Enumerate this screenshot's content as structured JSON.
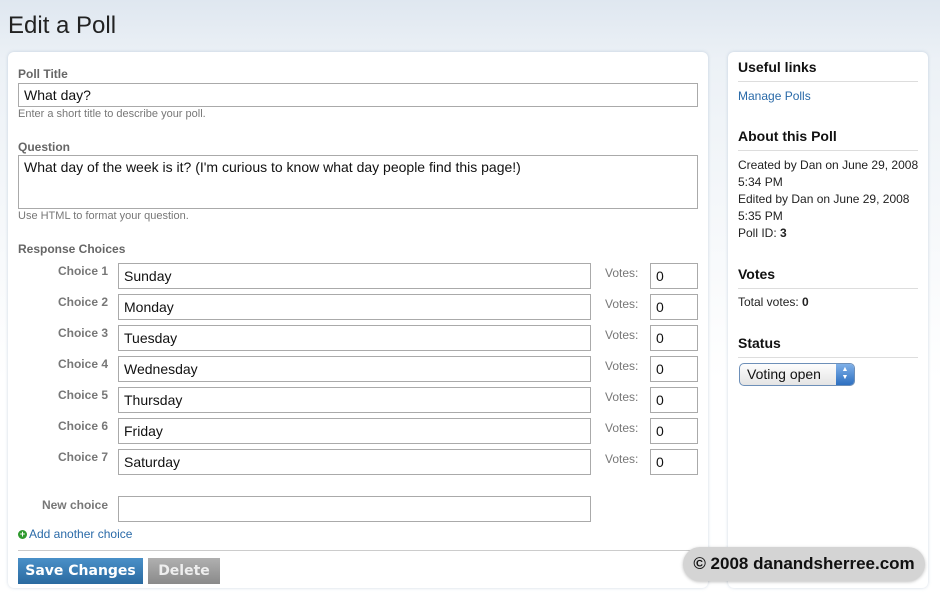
{
  "page": {
    "title": "Edit a Poll"
  },
  "form": {
    "poll_title": {
      "label": "Poll Title",
      "value": "What day?",
      "help": "Enter a short title to describe your poll."
    },
    "question": {
      "label": "Question",
      "value": "What day of the week is it? (I'm curious to know what day people find this page!)",
      "help": "Use HTML to format your question."
    },
    "responses_label": "Response Choices",
    "votes_label": "Votes:",
    "choices": [
      {
        "label": "Choice 1",
        "value": "Sunday",
        "votes": "0"
      },
      {
        "label": "Choice 2",
        "value": "Monday",
        "votes": "0"
      },
      {
        "label": "Choice 3",
        "value": "Tuesday",
        "votes": "0"
      },
      {
        "label": "Choice 4",
        "value": "Wednesday",
        "votes": "0"
      },
      {
        "label": "Choice 5",
        "value": "Thursday",
        "votes": "0"
      },
      {
        "label": "Choice 6",
        "value": "Friday",
        "votes": "0"
      },
      {
        "label": "Choice 7",
        "value": "Saturday",
        "votes": "0"
      }
    ],
    "new_choice": {
      "label": "New choice",
      "value": ""
    },
    "add_choice_link": "Add another choice",
    "save_label": "Save Changes",
    "delete_label": "Delete"
  },
  "sidebar": {
    "useful_links_heading": "Useful links",
    "manage_polls_link": "Manage Polls",
    "about_heading": "About this Poll",
    "created": "Created by Dan on June 29, 2008 5:34 PM",
    "edited": "Edited by Dan on June 29, 2008 5:35 PM",
    "poll_id_label": "Poll ID:",
    "poll_id": "3",
    "votes_heading": "Votes",
    "total_votes_label": "Total votes:",
    "total_votes": "0",
    "status_heading": "Status",
    "status_value": "Voting open"
  },
  "watermark": "© 2008 danandsherree.com",
  "icons": {
    "add": "plus-circle-icon",
    "select": "select-arrows-icon"
  },
  "colors": {
    "primary_button": "#2a6aa0",
    "link": "#2a6aa8",
    "add_icon": "#2f9a2f"
  }
}
